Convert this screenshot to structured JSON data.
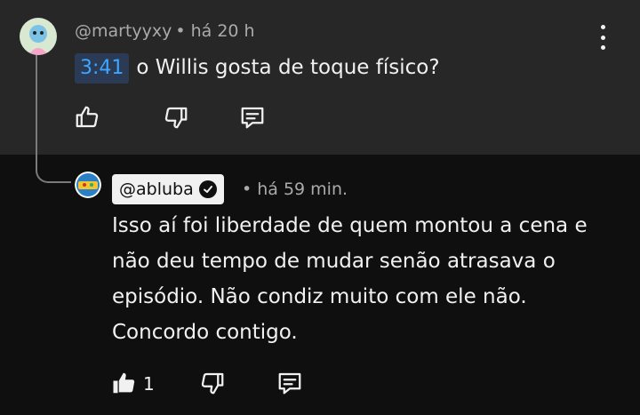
{
  "parent_comment": {
    "author": "@martyyxy",
    "separator": "•",
    "time": "há 20 h",
    "timestamp_link": "3:41",
    "text": "o Willis gosta de toque físico?",
    "avatar_icon": "cartoon-character-avatar",
    "menu_icon": "more-vertical-icon",
    "actions": {
      "like_icon": "thumb-up-icon",
      "dislike_icon": "thumb-down-icon",
      "reply_icon": "reply-comment-icon"
    }
  },
  "reply_comment": {
    "author": "@abluba",
    "verified_icon": "verified-check-icon",
    "separator": "•",
    "time": "há 59 min.",
    "text": "Isso aí foi liberdade de quem montou a cena e não deu tempo de mudar senão atrasava o episódio. Não condiz muito com ele não. Concordo contigo.",
    "avatar_icon": "channel-logo-avatar",
    "actions": {
      "like_icon": "thumb-up-filled-icon",
      "like_count": "1",
      "dislike_icon": "thumb-down-icon",
      "reply_icon": "reply-comment-icon"
    }
  },
  "colors": {
    "parent_bg": "#272727",
    "reply_bg": "#0f0f0f",
    "link_blue": "#3ea6ff",
    "meta_gray": "#aaaaaa"
  }
}
